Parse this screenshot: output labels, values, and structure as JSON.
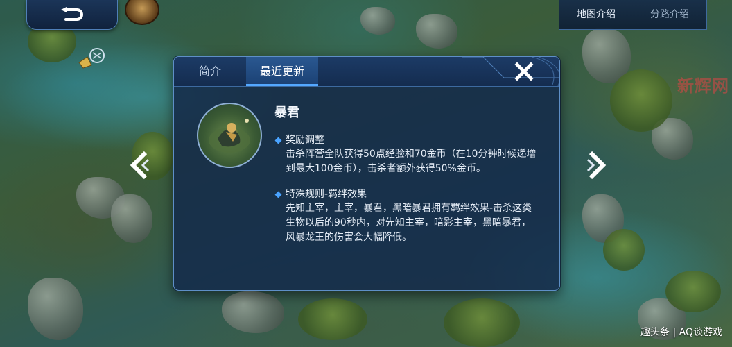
{
  "top_tabs": {
    "map_intro": "地图介绍",
    "lane_intro": "分路介绍"
  },
  "dialog": {
    "tabs": [
      "简介",
      "最近更新"
    ],
    "active_tab": "最近更新",
    "boss_name": "暴君",
    "sections": [
      {
        "title": "奖励调整",
        "body": "击杀阵营全队获得50点经验和70金币（在10分钟时候递增\n到最大100金币），击杀者额外获得50%金币。"
      },
      {
        "title": "特殊规则-羁绊效果",
        "body": "先知主宰，主宰，暴君，黑暗暴君拥有羁绊效果-击杀这类\n生物以后的90秒内，对先知主宰，暗影主宰，黑暗暴君，\n风暴龙王的伤害会大幅降低。"
      }
    ]
  },
  "watermarks": {
    "top_right": "新辉网",
    "bottom_right": "趣头条 | AQ谈游戏"
  },
  "colors": {
    "panel_bg": "#142a4a",
    "panel_border": "#5e8fc7",
    "tab_active_underline": "#54a8ff",
    "bullet": "#4aa3ff"
  },
  "icons": {
    "back": "back-arrow-icon",
    "close": "close-icon",
    "prev": "chevron-left-icon",
    "next": "chevron-right-icon"
  }
}
